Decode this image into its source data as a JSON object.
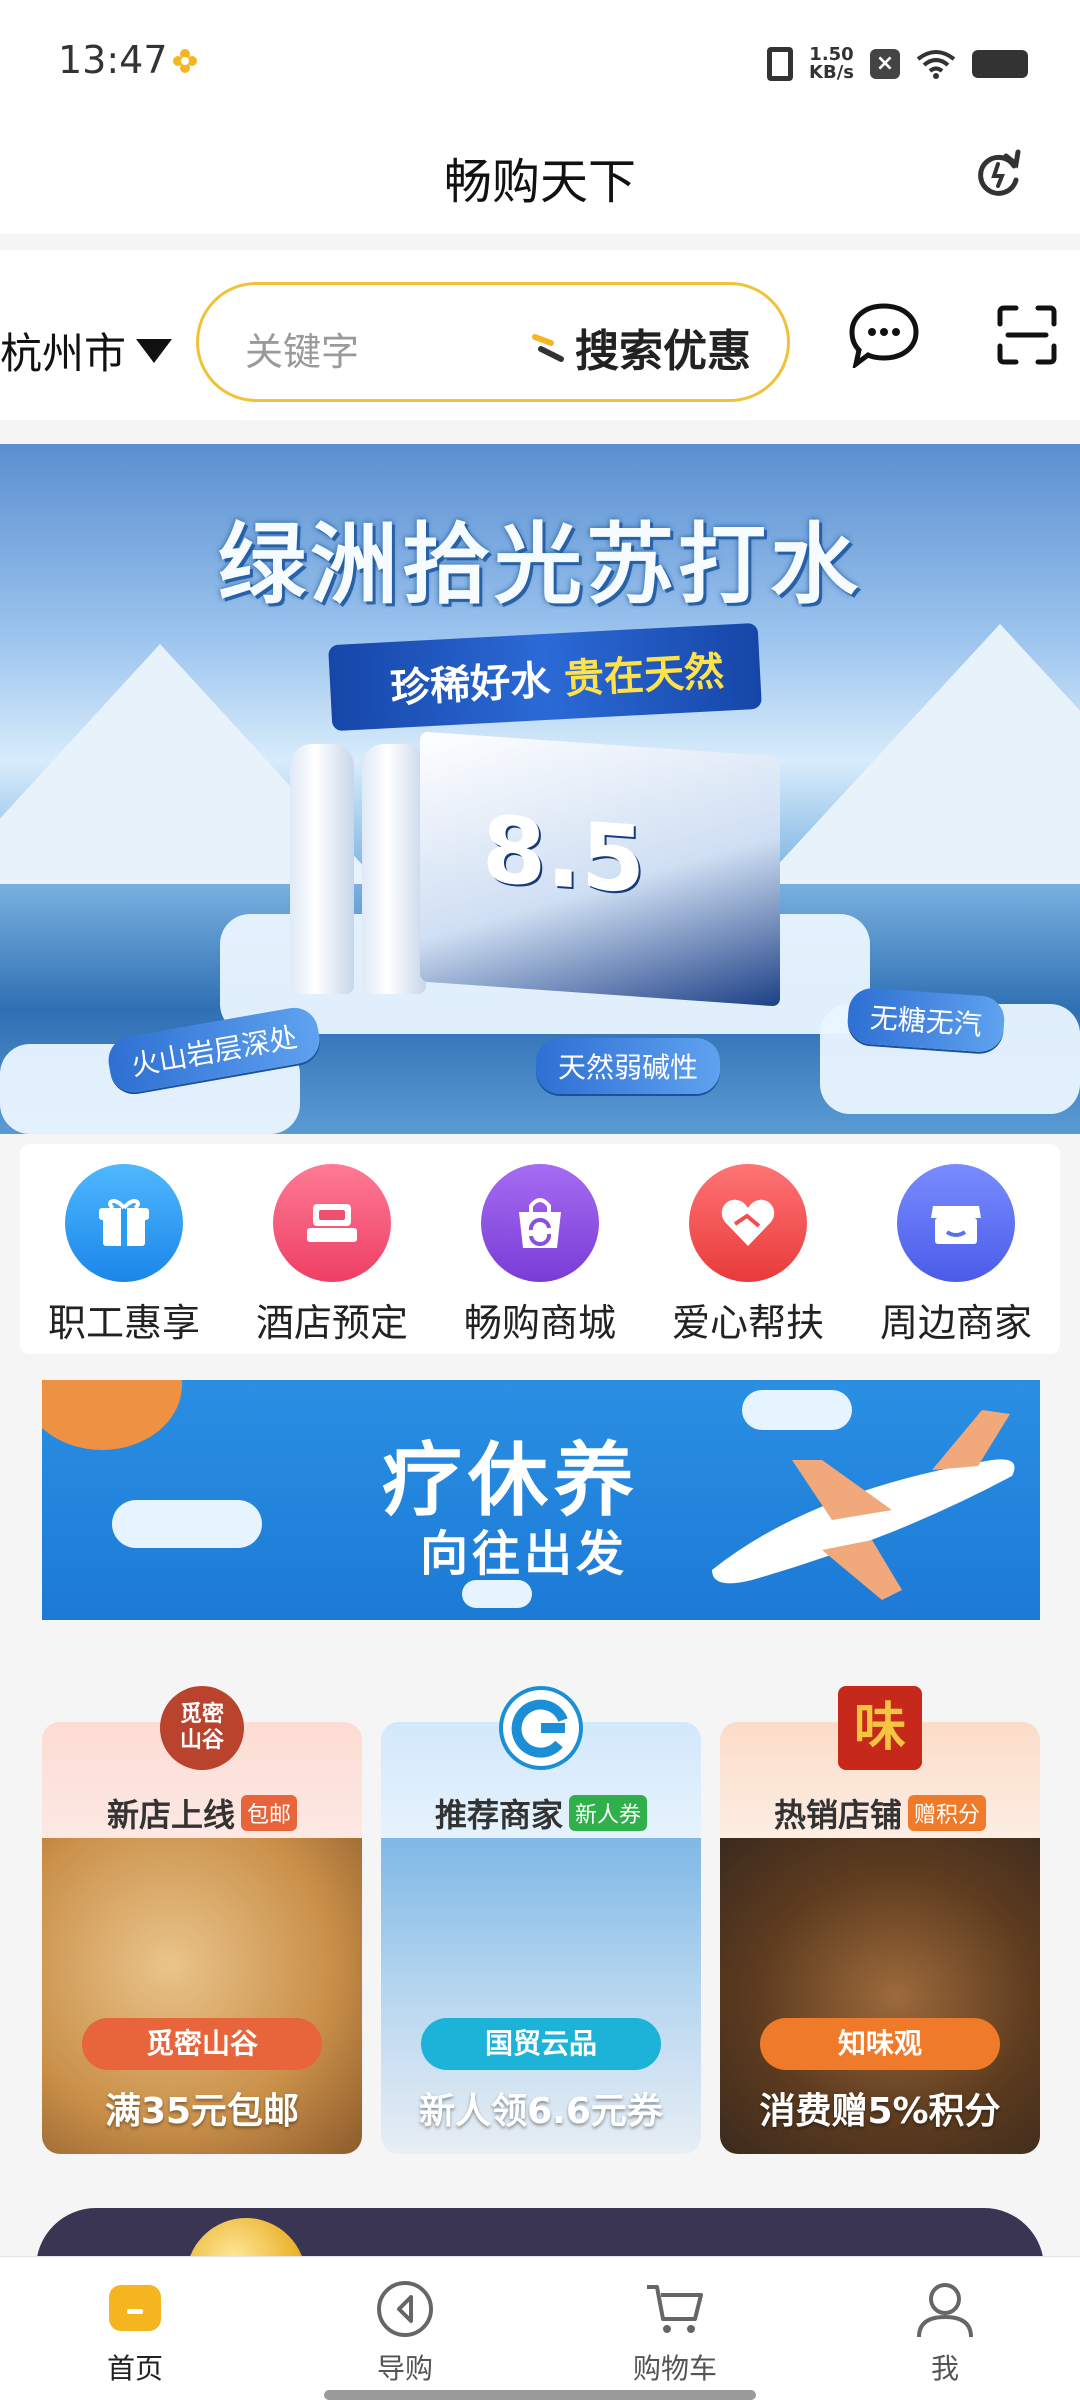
{
  "status_bar": {
    "time": "13:47",
    "net_speed_value": "1.50",
    "net_speed_unit": "KB/s"
  },
  "header": {
    "title": "畅购天下"
  },
  "search": {
    "city": "杭州市",
    "placeholder": "关键字",
    "button_label": "搜索优惠"
  },
  "banner": {
    "title": "绿洲拾光苏打水",
    "ribbon_left": "珍稀好水",
    "ribbon_right": "贵在天然",
    "product_number": "8.5",
    "tags": [
      "火山岩层深处",
      "天然弱碱性",
      "无糖无汽"
    ]
  },
  "menu": {
    "items": [
      {
        "label": "职工惠享",
        "icon": "gift-icon",
        "color": "#2a9df0"
      },
      {
        "label": "酒店预定",
        "icon": "hotel-bed-icon",
        "color": "#f0506e"
      },
      {
        "label": "畅购商城",
        "icon": "shopping-bag-icon",
        "color": "#8a4fe0"
      },
      {
        "label": "爱心帮扶",
        "icon": "heart-hands-icon",
        "color": "#f24e4e"
      },
      {
        "label": "周边商家",
        "icon": "storefront-icon",
        "color": "#5a6fef"
      }
    ]
  },
  "promo": {
    "title": "疗休养",
    "subtitle": "向往出发"
  },
  "cards": [
    {
      "title": "新店上线",
      "badge": "包邮",
      "logo_text": "觅密\n山谷",
      "store": "觅密山谷",
      "offer": "满35元包邮",
      "accent": "#e8643a",
      "head_bg": "#fde3de"
    },
    {
      "title": "推荐商家",
      "badge": "新人券",
      "logo_text": "",
      "store": "国贸云品",
      "offer": "新人领6.6元券",
      "accent": "#1db2d8",
      "head_bg": "#dbeefb"
    },
    {
      "title": "热销店铺",
      "badge": "赠积分",
      "logo_text": "味",
      "store": "知味观",
      "offer": "消费赠5%积分",
      "accent": "#ef7a2a",
      "head_bg": "#fde6d6"
    }
  ],
  "tabs": [
    {
      "label": "首页",
      "icon": "home-icon",
      "active": true
    },
    {
      "label": "导购",
      "icon": "compass-icon",
      "active": false
    },
    {
      "label": "购物车",
      "icon": "cart-icon",
      "active": false
    },
    {
      "label": "我",
      "icon": "user-icon",
      "active": false
    }
  ],
  "colors": {
    "accent": "#f5b51f",
    "search_border": "#f0c23a"
  }
}
